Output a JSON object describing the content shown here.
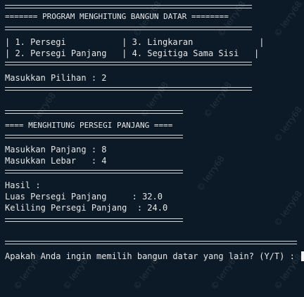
{
  "header": {
    "title_line": "======= PROGRAM MENGHITUNG BANGUN DATAR ========",
    "menu_row_1": "| 1. Persegi           | 3. Lingkaran             |",
    "menu_row_2": "| 2. Persegi Panjang   | 4. Segitiga Sama Sisi   |"
  },
  "prompt_choice": "Masukkan Pilihan : 2",
  "section": {
    "title_line": "==== MENGHITUNG PERSEGI PANJANG ====",
    "input_length": "Masukkan Panjang : 8",
    "input_width": "Masukkan Lebar   : 4"
  },
  "result": {
    "label": "Hasil :",
    "area": "Luas Persegi Panjang     : 32.0",
    "perimeter": "Keliling Persegi Panjang  : 24.0"
  },
  "repeat_prompt": "Apakah Anda ingin memilih bangun datar yang lain? (Y/T) : ",
  "watermark": "© lerry68"
}
